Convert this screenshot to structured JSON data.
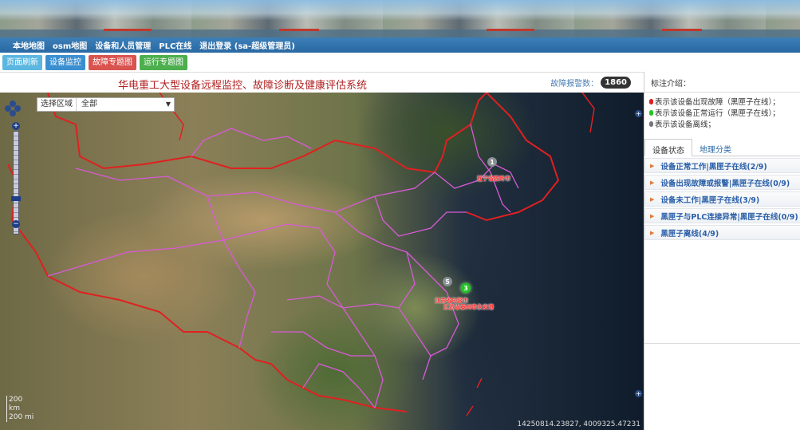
{
  "nav": {
    "items": [
      "本地地图",
      "osm地图",
      "设备和人员管理",
      "PLC在线",
      "退出登录 (sa-超级管理员)"
    ]
  },
  "toolbar": {
    "buttons": [
      "页面刷新",
      "设备监控",
      "故障专题图",
      "运行专题图"
    ]
  },
  "header": {
    "title": "华电重工大型设备远程监控、故障诊断及健康评估系统",
    "alarm_label": "故障报警数：",
    "alarm_count": "1860"
  },
  "map": {
    "region_label": "选择区域",
    "region_value": "全部",
    "scale_top": "200",
    "scale_unit": "km",
    "scale_bottom": "200 mi",
    "coordinates": "14250814.23827, 4009325.47231",
    "markers": [
      {
        "count": "1",
        "label": "辽宁省铁岭市",
        "color": "#8a8f96"
      },
      {
        "count": "5",
        "label": "江苏省句容市",
        "color": "#8a8f96"
      },
      {
        "count": "3",
        "label": "江苏省泰州市永安港",
        "color": "#22c422"
      }
    ]
  },
  "panel": {
    "legend_title": "标注介绍：",
    "legend": [
      {
        "text": "表示该设备出现故障（黑匣子在线）；",
        "color": "#e02020"
      },
      {
        "text": "表示该设备正常运行（黑匣子在线）；",
        "color": "#22c422"
      },
      {
        "text": "表示该设备离线；",
        "color": "#777777"
      }
    ],
    "tabs": [
      "设备状态",
      "地理分类"
    ],
    "groups": [
      "设备正常工作|黑匣子在线(2/9)",
      "设备出现故障或报警|黑匣子在线(0/9)",
      "设备未工作|黑匣子在线(3/9)",
      "黑匣子与PLC连接异常|黑匣子在线(0/9)",
      "黑匣子离线(4/9)"
    ]
  }
}
